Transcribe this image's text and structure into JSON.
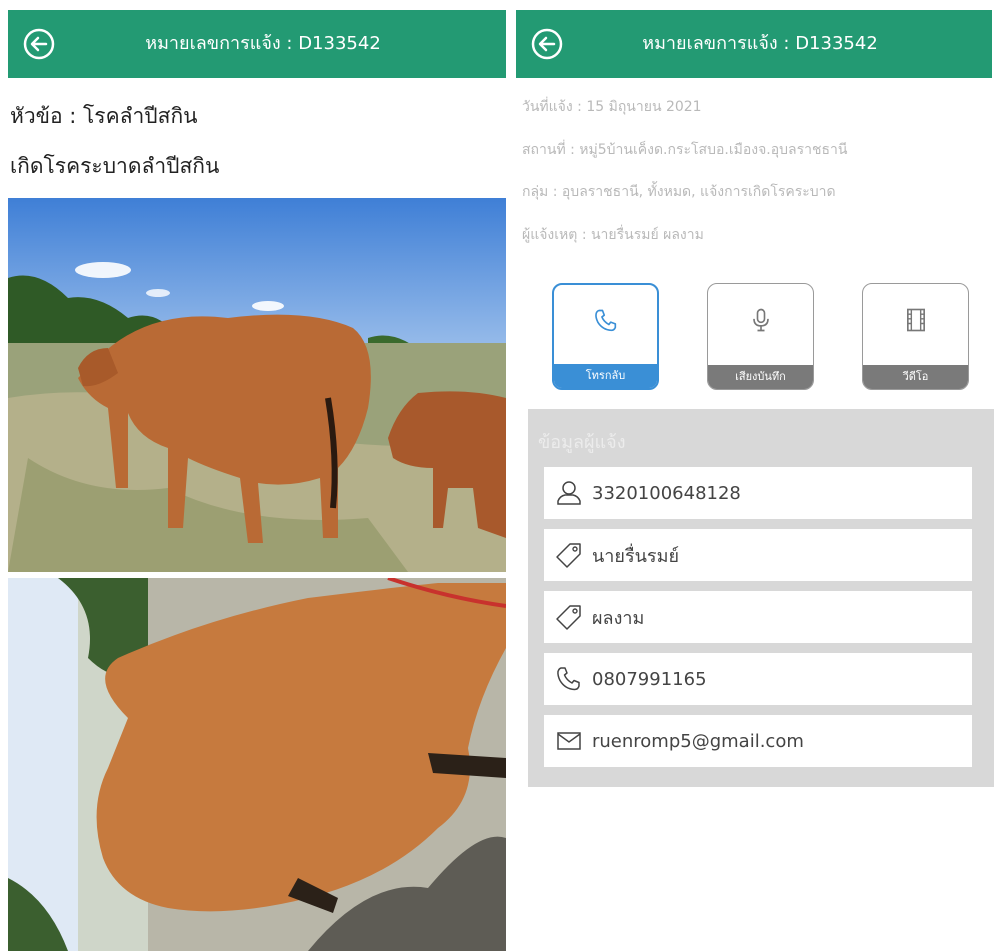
{
  "left_panel": {
    "header": {
      "title": "หมายเลขการแจ้ง : D133542"
    },
    "topic": "หัวข้อ :  โรคลำปีสกิน",
    "description": "เกิดโรคระบาดลำปีสกิน",
    "photos": [
      {
        "icon": "cattle-photo-1"
      },
      {
        "icon": "cattle-photo-2"
      }
    ]
  },
  "right_panel": {
    "header": {
      "title": "หมายเลขการแจ้ง : D133542"
    },
    "meta": {
      "date": "วันที่แจ้ง : 15 มิถุนายน 2021",
      "place": "สถานที่ : หมู่5บ้านเค็งด.กระโสบอ.เมืองจ.อุบลราชธานี",
      "group": "กลุ่ม : อุบลราชธานี, ทั้งหมด, แจ้งการเกิดโรคระบาด",
      "reporter": "ผู้แจ้งเหตุ : นายรื่นรมย์ ผลงาม"
    },
    "actions": [
      {
        "label": "โทรกลับ",
        "icon": "phone-icon",
        "color": "#3a8fd6"
      },
      {
        "label": "เสียงบันทึก",
        "icon": "microphone-icon",
        "color": "#7a7a7a"
      },
      {
        "label": "วีดีโอ",
        "icon": "film-icon",
        "color": "#7a7a7a"
      }
    ],
    "info": {
      "title": "ข้อมูลผู้แจ้ง",
      "id_number": "3320100648128",
      "first_name": "นายรื่นรมย์",
      "last_name": "ผลงาม",
      "phone": "0807991165",
      "email": "ruenromp5@gmail.com"
    }
  },
  "colors": {
    "header": "#239a73",
    "call_accent": "#3a8fd6",
    "info_bg": "#d8d8d8"
  }
}
